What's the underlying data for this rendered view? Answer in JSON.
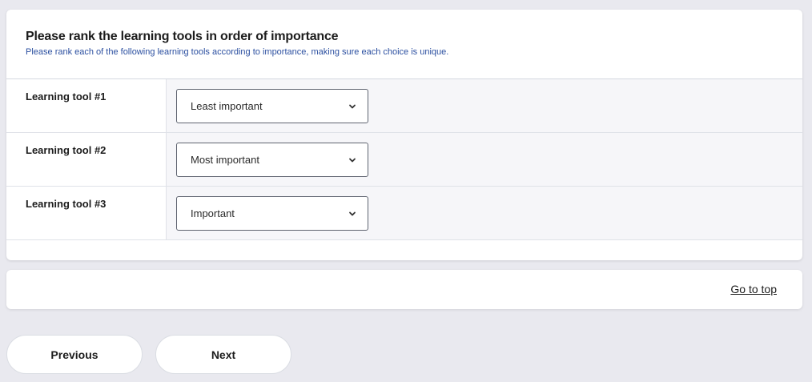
{
  "question": {
    "title": "Please rank the learning tools in order of importance",
    "subtitle": "Please rank each of the following learning tools according to importance, making sure each choice is unique.",
    "rows": [
      {
        "label": "Learning tool #1",
        "selected": "Least important"
      },
      {
        "label": "Learning tool #2",
        "selected": "Most important"
      },
      {
        "label": "Learning tool #3",
        "selected": "Important"
      }
    ]
  },
  "nav": {
    "go_top": "Go to top",
    "previous": "Previous",
    "next": "Next"
  },
  "icons": {
    "dropdown": "chevron-down-icon"
  },
  "colors": {
    "background": "#e9e9ef",
    "subtitle": "#2b4fa0",
    "cell_bg": "#f6f6f9"
  }
}
